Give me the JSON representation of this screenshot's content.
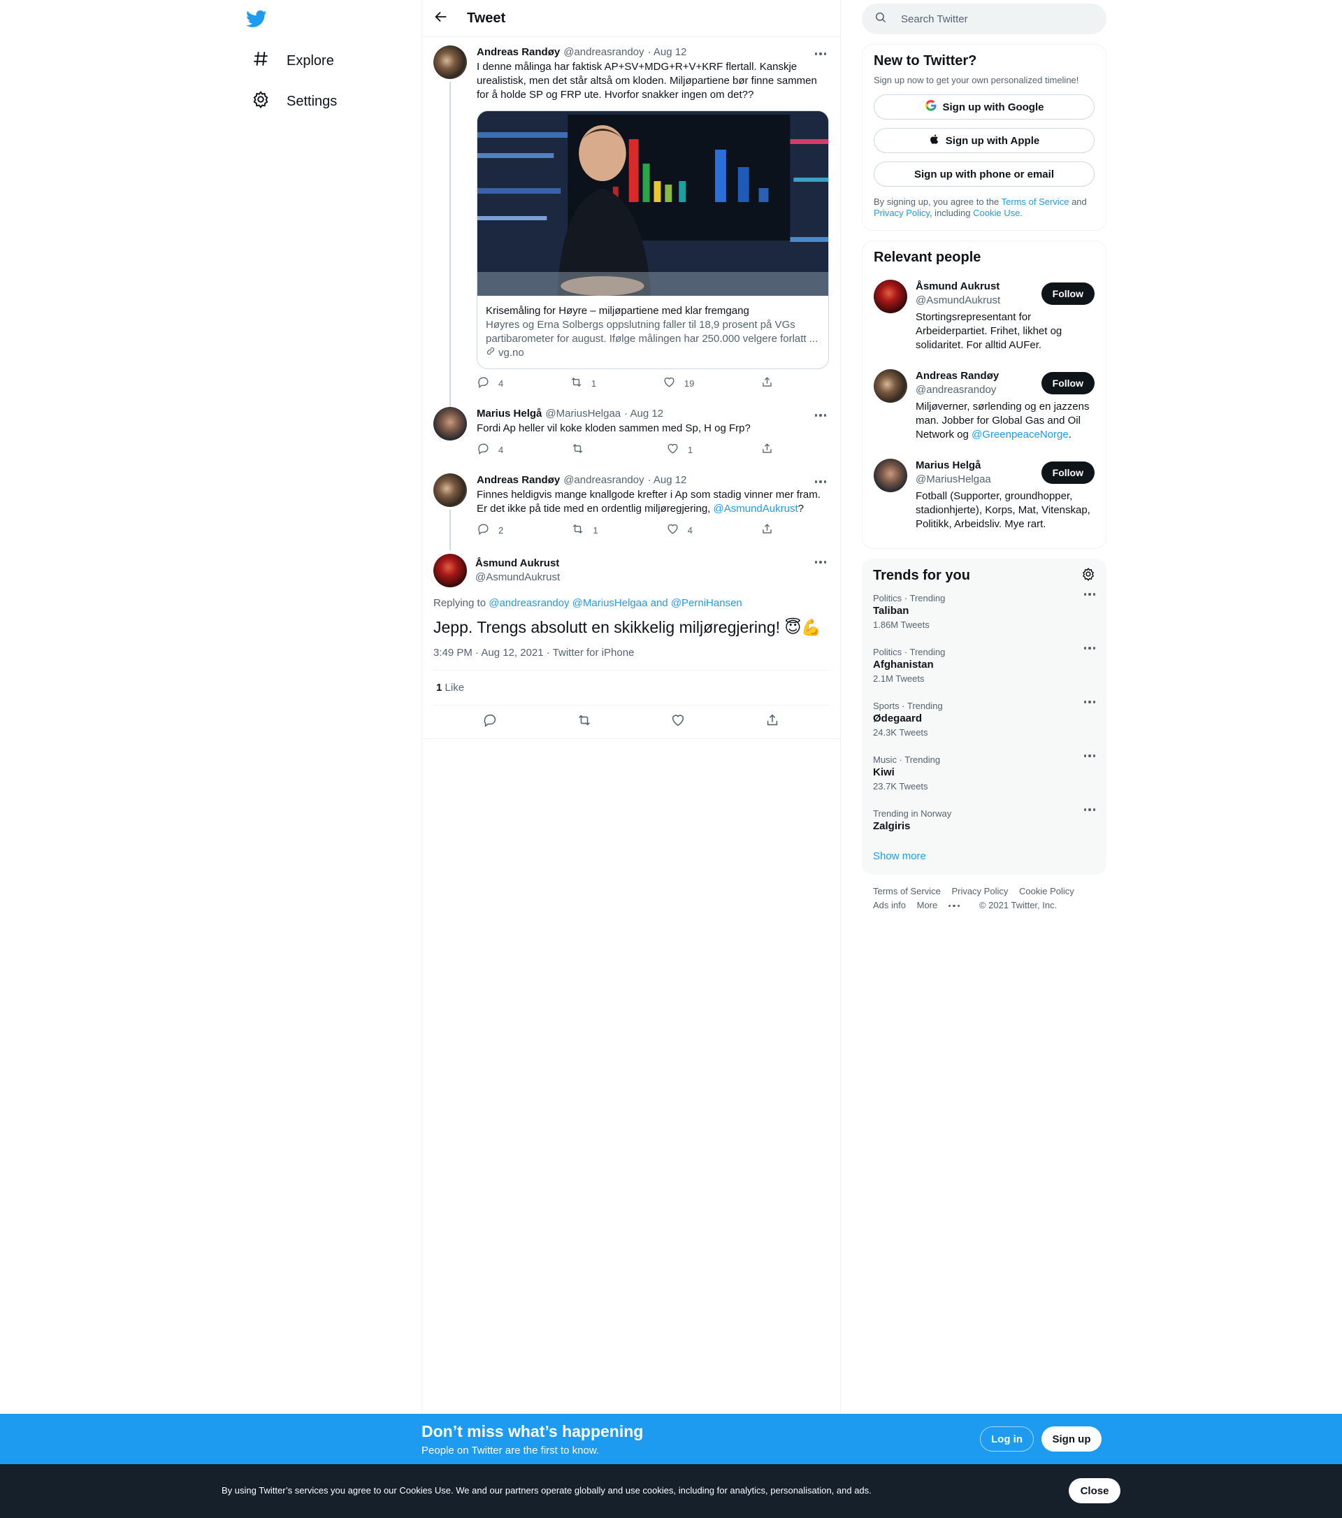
{
  "colors": {
    "accent": "#1d9bf0",
    "text": "#0f1419",
    "muted": "#536471"
  },
  "nav": {
    "logo_icon": "twitter-bird-icon",
    "items": [
      {
        "label": "Explore",
        "icon": "hashtag-icon"
      },
      {
        "label": "Settings",
        "icon": "gear-icon"
      }
    ]
  },
  "header": {
    "title": "Tweet",
    "back_icon": "back-arrow-icon"
  },
  "tweets": [
    {
      "name": "Andreas Randøy",
      "handle": "@andreasrandoy",
      "date": "· Aug 12",
      "text": "I denne målinga har faktisk AP+SV+MDG+R+V+KRF flertall. Kanskje urealistisk, men det står altså om kloden. Miljøpartiene bør finne sammen for å holde SP og FRP ute. Hvorfor snakker ingen om det??",
      "card": {
        "title": "Krisemåling for Høyre – miljøpartiene med klar fremgang",
        "description": "Høyres og Erna Solbergs oppslutning faller til 18,9 prosent på VGs partibarometer for august. Ifølge målingen har 250.000 velgere forlatt ...",
        "domain": "vg.no"
      },
      "replies": "4",
      "retweets": "1",
      "likes": "19"
    },
    {
      "name": "Marius Helgå",
      "handle": "@MariusHelgaa",
      "date": "· Aug 12",
      "text": "Fordi Ap heller vil koke kloden sammen med Sp, H og Frp?",
      "replies": "4",
      "retweets": "",
      "likes": "1"
    },
    {
      "name": "Andreas Randøy",
      "handle": "@andreasrandoy",
      "date": "· Aug 12",
      "text_before": "Finnes heldigvis mange knallgode krefter i Ap som stadig vinner mer fram. Er det ikke på tide med en ordentlig miljøregjering, ",
      "mention": "@AsmundAukrust",
      "text_after": "?",
      "replies": "2",
      "retweets": "1",
      "likes": "4"
    }
  ],
  "main_tweet": {
    "name": "Åsmund Aukrust",
    "handle": "@AsmundAukrust",
    "replying_label": "Replying to",
    "replying_to": "@andreasrandoy @MariusHelgaa and @PerniHansen",
    "text": "Jepp. Trengs absolutt en skikkelig miljøregjering! 😇💪",
    "meta": "3:49 PM · Aug 12, 2021 · Twitter for iPhone",
    "like_count": "1",
    "like_label": "Like"
  },
  "right": {
    "search_placeholder": "Search Twitter",
    "new": {
      "title": "New to Twitter?",
      "subtitle": "Sign up now to get your own personalized timeline!",
      "google": "Sign up with Google",
      "apple": "Sign up with Apple",
      "phone": "Sign up with phone or email",
      "legal_1": "By signing up, you agree to the",
      "tos": "Terms of Service",
      "and": "and",
      "privacy": "Privacy Policy",
      "including": ", including",
      "cookie": "Cookie Use."
    },
    "relevant": {
      "title": "Relevant people",
      "follow_label": "Follow",
      "people": [
        {
          "name": "Åsmund Aukrust",
          "handle": "@AsmundAukrust",
          "bio": "Stortingsrepresentant for Arbeiderpartiet. Frihet, likhet og solidaritet. For alltid AUFer."
        },
        {
          "name": "Andreas Randøy",
          "handle": "@andreasrandoy",
          "bio": "Miljøverner, sørlending og en jazzens man. Jobber for Global Gas and Oil Network og ",
          "bio_link": "@GreenpeaceNorge",
          "bio_end": "."
        },
        {
          "name": "Marius Helgå",
          "handle": "@MariusHelgaa",
          "bio": "Fotball (Supporter, groundhopper, stadionhjerte), Korps, Mat, Vitenskap, Politikk, Arbeidsliv. Mye rart."
        }
      ]
    },
    "trends": {
      "title": "Trends for you",
      "items": [
        {
          "category": "Politics · Trending",
          "name": "Taliban",
          "count": "1.86M Tweets"
        },
        {
          "category": "Politics · Trending",
          "name": "Afghanistan",
          "count": "2.1M Tweets"
        },
        {
          "category": "Sports · Trending",
          "name": "Ødegaard",
          "count": "24.3K Tweets"
        },
        {
          "category": "Music · Trending",
          "name": "Kiwi",
          "count": "23.7K Tweets"
        },
        {
          "category": "Trending in Norway",
          "name": "Zalgiris",
          "count": ""
        }
      ],
      "show_more": "Show more"
    },
    "footer": {
      "tos": "Terms of Service",
      "privacy": "Privacy Policy",
      "cookie": "Cookie Policy",
      "ads": "Ads info",
      "more": "More",
      "copyright": "© 2021 Twitter, Inc."
    }
  },
  "signup_bar": {
    "title": "Don’t miss what’s happening",
    "subtitle": "People on Twitter are the first to know.",
    "login": "Log in",
    "signup": "Sign up"
  },
  "cookie_bar": {
    "text": "By using Twitter’s services you agree to our Cookies Use. We and our partners operate globally and use cookies, including for analytics, personalisation, and ads.",
    "close": "Close"
  }
}
